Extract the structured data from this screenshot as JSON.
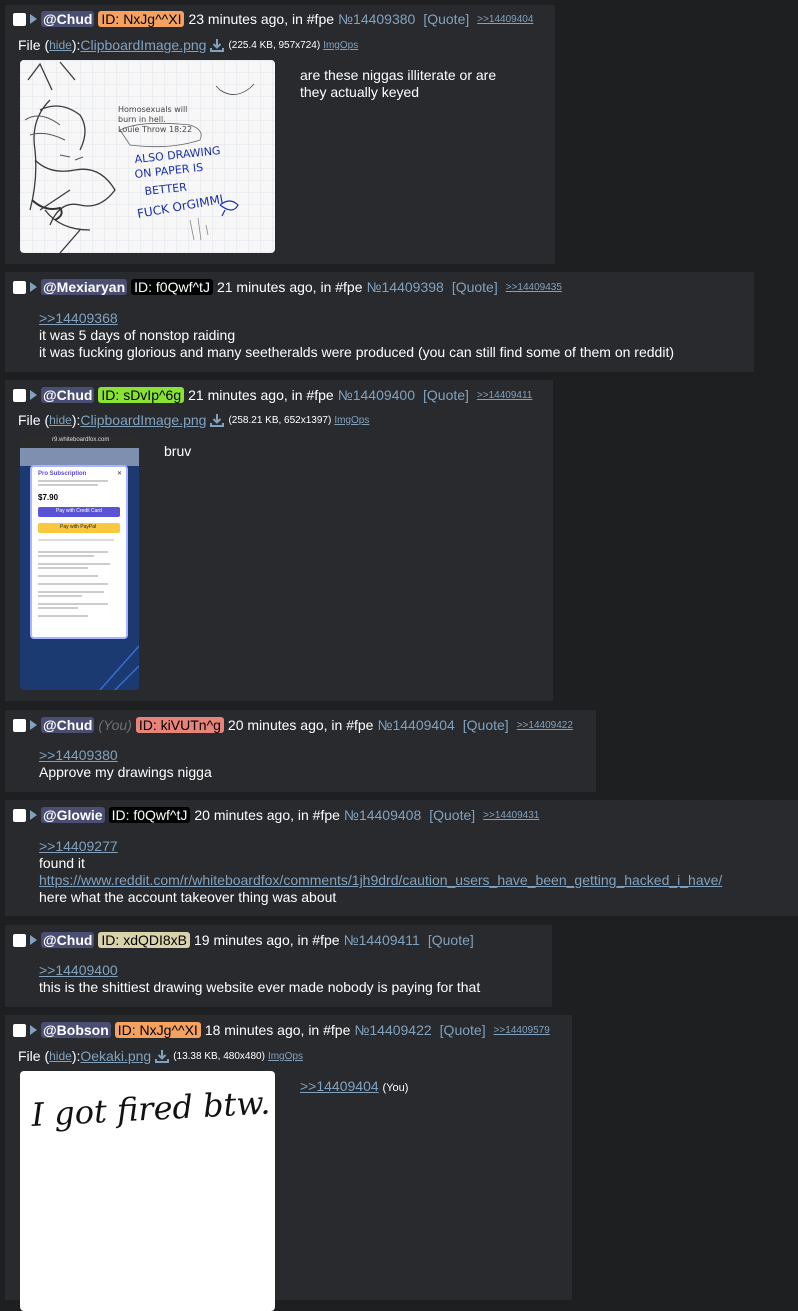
{
  "posts": [
    {
      "name": "@Chud",
      "id": "ID: NxJg^^XI",
      "time": "23 minutes ago, in #fpe",
      "no": "№14409380",
      "quote": "[Quote]",
      "backlink": ">>14409404",
      "file": {
        "label": "File (",
        "hide": "hide",
        "close": "): ",
        "name": "ClipboardImage.png",
        "info": "(225.4 KB, 957x724)",
        "imgops": "ImgOps"
      },
      "text": [
        "are these niggas illiterate or are",
        "they actually keyed"
      ],
      "sketch": [
        "Homosexuals will",
        "burn in hell.",
        "Louie Throw 18:22",
        "ALSO DRAWING",
        "ON PAPER IS",
        "BETTER",
        "FUCK OrGIMMI"
      ]
    },
    {
      "name": "@Mexiaryan",
      "id": "ID: f0Qwf^tJ",
      "time": "21 minutes ago, in #fpe",
      "no": "№14409398",
      "quote": "[Quote]",
      "backlink": ">>14409435",
      "reply": ">>14409368",
      "text": [
        "it was 5 days of nonstop raiding",
        "it was fucking glorious and many seetheralds were produced (you can still find some of them on reddit)"
      ]
    },
    {
      "name": "@Chud",
      "id": "ID: sDvIp^6g",
      "time": "21 minutes ago, in #fpe",
      "no": "№14409400",
      "quote": "[Quote]",
      "backlink": ">>14409411",
      "file": {
        "label": "File (",
        "hide": "hide",
        "close": "): ",
        "name": "ClipboardImage.png",
        "info": "(258.21 KB, 652x1397)",
        "imgops": "ImgOps"
      },
      "text": [
        "bruv"
      ],
      "phone": {
        "url": "r9.whiteboardfox.com",
        "title": "Pro Subscription",
        "price": "$7.90",
        "card": "Pay with Credit Card",
        "paypal": "Pay with PayPal"
      }
    },
    {
      "name": "@Chud",
      "you": "(You)",
      "id": "ID: kiVUTn^g",
      "time": "20 minutes ago, in #fpe",
      "no": "№14409404",
      "quote": "[Quote]",
      "backlink": ">>14409422",
      "reply": ">>14409380",
      "text": [
        "Approve my drawings nigga"
      ]
    },
    {
      "name": "@Glowie",
      "id": "ID: f0Qwf^tJ",
      "time": "20 minutes ago, in #fpe",
      "no": "№14409408",
      "quote": "[Quote]",
      "backlink": ">>14409431",
      "reply": ">>14409277",
      "text": [
        "found it"
      ],
      "url": "https://www.reddit.com/r/whiteboardfox/comments/1jh9drd/caution_users_have_been_getting_hacked_i_have/",
      "text2": "here what the account takeover thing was about"
    },
    {
      "name": "@Chud",
      "id": "ID: xdQDI8xB",
      "time": "19 minutes ago, in #fpe",
      "no": "№14409411",
      "quote": "[Quote]",
      "reply": ">>14409400",
      "text": [
        "this is the shittiest drawing website ever made nobody is paying for that"
      ]
    },
    {
      "name": "@Bobson",
      "id": "ID: NxJg^^XI",
      "time": "18 minutes ago, in #fpe",
      "no": "№14409422",
      "quote": "[Quote]",
      "backlink": ">>14409579",
      "file": {
        "label": "File (",
        "hide": "hide",
        "close": "): ",
        "name": "Oekaki.png",
        "info": "(13.38 KB, 480x480)",
        "imgops": "ImgOps"
      },
      "reply": ">>14409404",
      "you": "(You)",
      "handwriting": "I got fired btw."
    }
  ],
  "colors": {
    "id_orange": "#f5a15f",
    "id_black": "#000000",
    "id_green": "#8ae234",
    "id_red": "#e8837a",
    "id_tan": "#d8d3a8"
  }
}
